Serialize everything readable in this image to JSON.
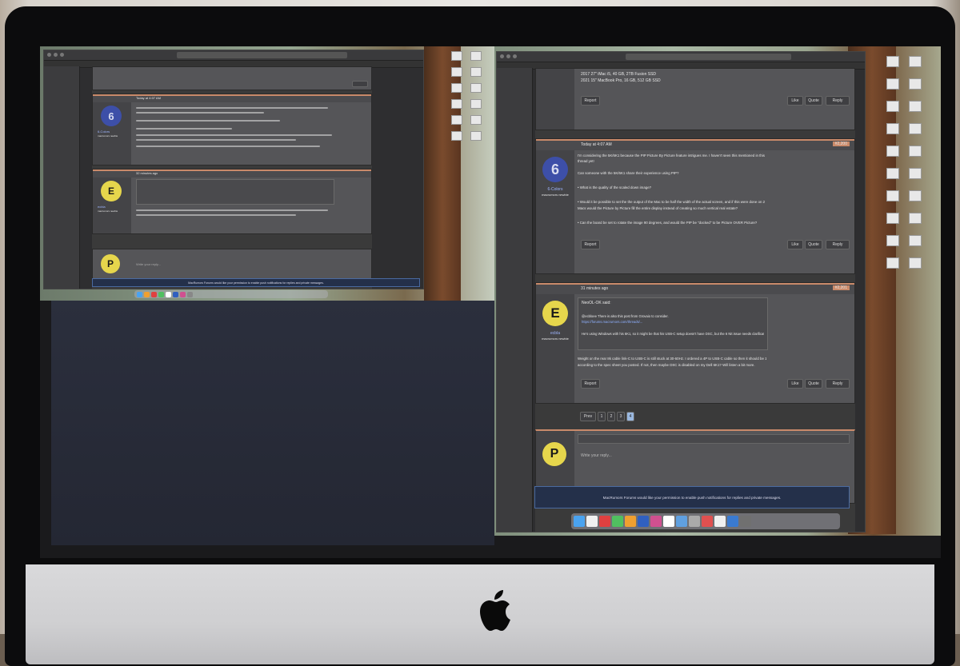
{
  "right_window": {
    "post1": {
      "footer_lines": [
        "2017 27\" iMac i5, 40 GB, 2TB Fusion SSD",
        "2021 15\" MacBook Pro, 16 GB, 512 GB SSD"
      ],
      "report_label": "Report",
      "like_label": "Like",
      "quote_label": "Quote",
      "reply_label": "Reply"
    },
    "post2": {
      "avatar_letter": "6",
      "username": "6-Colors",
      "user_role": "macrumors newbie",
      "timestamp": "Today at 4:07 AM",
      "post_number": "#2,200",
      "body_lines": [
        "I'm considering the 5K/6K1 because the PIP Picture By Picture feature intrigues me. I haven't seen this mentioned in this",
        "thread yet!",
        "Can someone with the 5K/6K1 share their experience using PIP?",
        "• What is the quality of the scaled down image?",
        "• Would it be possible to set the the output of the Mac to be half the width of the actual screen, and if this were done on 2",
        "Macs would the Picture by Picture fill the entire display instead of creating so much vertical real estate?",
        "• Can the board be set to rotate the image 90 degrees, and would the PIP be \"docked\" to be Picture OVER Picture?"
      ],
      "report_label": "Report",
      "like_label": "Like",
      "quote_label": "Quote",
      "reply_label": "Reply"
    },
    "post3": {
      "avatar_letter": "E",
      "username": "ecbla",
      "user_role": "macrumors newbie",
      "timestamp": "31 minutes ago",
      "post_number": "#2,201",
      "quote_author": "NeoOL-OK said:",
      "quote_lines": [
        "@ecbloee There is also this post from Grovaio to consider.",
        "https://forums.macrumors.com/threads/...",
        "He's using Windows with his 6K1, so it might be that his USB-C setup doesn't have DSC, but the 6 Nit issue needs clarification."
      ],
      "body_lines": [
        "Weight on the rear 8k cable link-C to USB-C is still stuck at 30-60Hz. I ordered a 4P to USB-C cable so then it should be 10Gb",
        "according to the spec sheet you posted. If not, then maybe DSC is disabled on my Dell 6K1? Will listen a bit more."
      ],
      "report_label": "Report",
      "like_label": "Like",
      "quote_label": "Quote",
      "reply_label": "Reply"
    },
    "pagination": [
      "Prev",
      "1",
      "2",
      "3",
      "4"
    ],
    "reply_box": {
      "avatar_letter": "P",
      "placeholder": "Write your reply..."
    },
    "notice": "MacRumors Forums would like your permission to enable push notifications for replies and private messages."
  },
  "left_window": {
    "post2": {
      "avatar_letter": "6",
      "username": "6-Colors",
      "user_role": "macrumors newbie",
      "timestamp": "Today at 4:07 AM"
    },
    "post3": {
      "avatar_letter": "E",
      "username": "ecbla",
      "user_role": "macrumors newbie",
      "timestamp": "32 minutes ago"
    },
    "reply_box": {
      "avatar_letter": "P",
      "placeholder": "Write your reply..."
    },
    "notice": "MacRumors Forums would like your permission to enable push notifications for replies and private messages."
  },
  "colors": {
    "accent_header": "#c98a6a",
    "avatar_blue": "#3d4fa8",
    "avatar_yellow": "#e6d64c",
    "link": "#6a8fd0"
  }
}
